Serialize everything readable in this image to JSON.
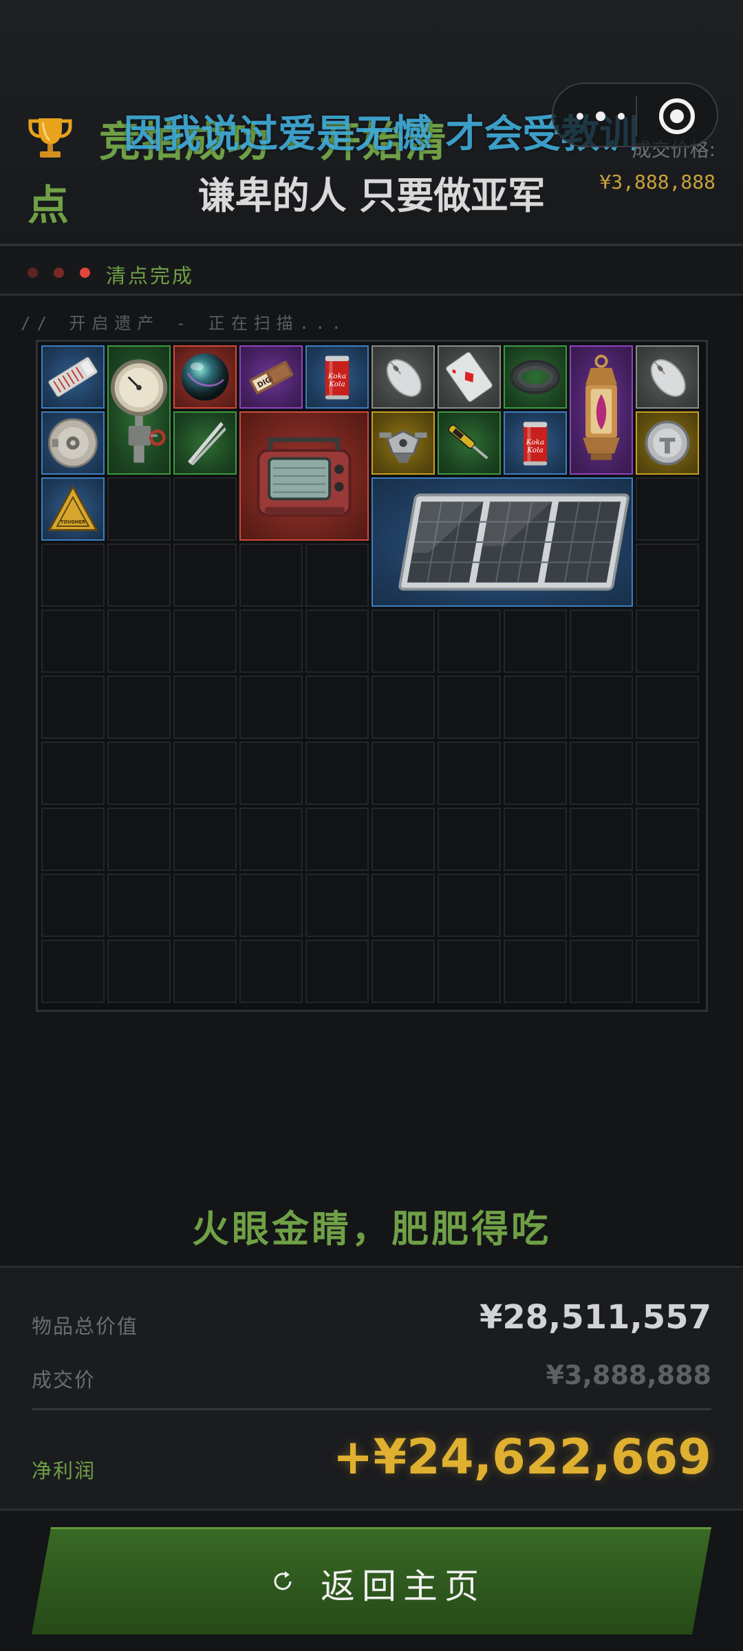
{
  "header": {
    "title_line1": "竞拍成功 - 开始清",
    "title_line2": "点",
    "lyric_line1": "因我说过爱是无憾 才会受教训",
    "lyric_line2": "谦卑的人 只要做亚军",
    "deal_label": "成交价格:",
    "deal_value": "¥3,888,888"
  },
  "status": {
    "text": "清点完成",
    "dot_colors": [
      "#5a2524",
      "#7a2a26",
      "#e0473a"
    ]
  },
  "scan_text": "// 开启遗产 - 正在扫描...",
  "inventory": {
    "columns": 10,
    "rows": 10,
    "items": [
      {
        "name": "ammo-pack-icon",
        "quality": "blue"
      },
      {
        "name": "pressure-gauge-icon",
        "quality": "green"
      },
      {
        "name": "glass-orb-icon",
        "quality": "red"
      },
      {
        "name": "energy-bar-icon",
        "quality": "purple",
        "label": "DIGI"
      },
      {
        "name": "soda-can-icon",
        "quality": "blue",
        "label": "Koka Kola"
      },
      {
        "name": "computer-mouse-icon",
        "quality": "gray"
      },
      {
        "name": "playing-card-icon",
        "quality": "gray"
      },
      {
        "name": "coiled-cable-icon",
        "quality": "green"
      },
      {
        "name": "ornate-lantern-icon",
        "quality": "purple"
      },
      {
        "name": "computer-mouse-icon",
        "quality": "gray"
      },
      {
        "name": "disc-drive-icon",
        "quality": "blue"
      },
      {
        "name": "tweezers-icon",
        "quality": "green"
      },
      {
        "name": "portable-radio-icon",
        "quality": "red"
      },
      {
        "name": "drone-part-icon",
        "quality": "gold"
      },
      {
        "name": "screwdriver-tool-icon",
        "quality": "green"
      },
      {
        "name": "soda-can-icon",
        "quality": "blue",
        "label": "Koka Kola"
      },
      {
        "name": "metal-token-icon",
        "quality": "gold"
      },
      {
        "name": "warning-sign-icon",
        "quality": "blue",
        "label": "TOUGHER"
      },
      {
        "name": "solar-panel-icon",
        "quality": "blue"
      }
    ]
  },
  "slogan": "火眼金睛，肥肥得吃",
  "summary": {
    "total_label": "物品总价值",
    "total_value": "¥28,511,557",
    "deal_label": "成交价",
    "deal_value": "¥3,888,888",
    "profit_label": "净利润",
    "profit_value": "+¥24,622,669"
  },
  "actions": {
    "home_label": "返回主页"
  },
  "colors": {
    "accent_green": "#6fa046",
    "gold": "#e0b030",
    "blue_text": "#3fa9d6"
  }
}
